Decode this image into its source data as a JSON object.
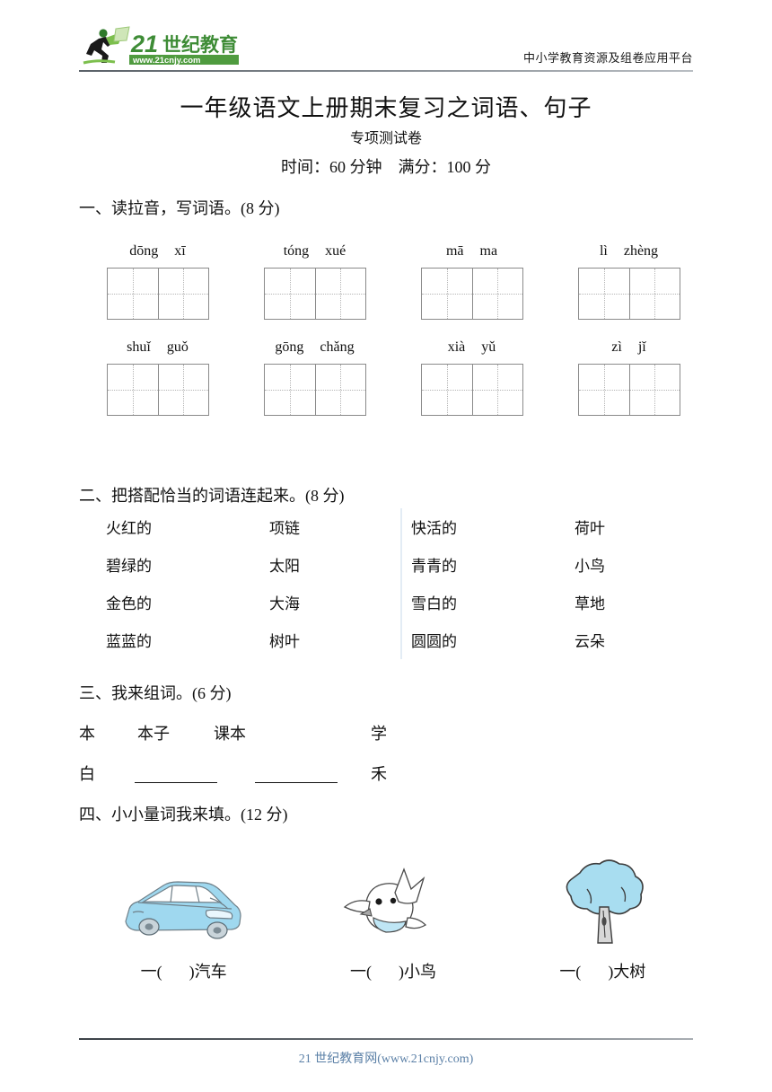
{
  "header": {
    "logo_number": "21",
    "logo_cn": "世纪教育",
    "logo_url": "www.21cnjy.com",
    "tagline": "中小学教育资源及组卷应用平台"
  },
  "title": {
    "main": "一年级语文上册期末复习之词语、句子",
    "sub": "专项测试卷",
    "meta": "时间：60 分钟　满分：100 分"
  },
  "sections": {
    "s1_heading": "一、读拉音，写词语。(8 分)",
    "s2_heading": "二、把搭配恰当的词语连起来。(8 分)",
    "s3_heading": "三、我来组词。(6 分)",
    "s4_heading": "四、小小量词我来填。(12 分)"
  },
  "pinyin": {
    "row1": [
      {
        "s1": "dōng",
        "s2": "xī"
      },
      {
        "s1": "tóng",
        "s2": "xué"
      },
      {
        "s1": "mā",
        "s2": "ma"
      },
      {
        "s1": "lì",
        "s2": "zhèng"
      }
    ],
    "row2": [
      {
        "s1": "shuǐ",
        "s2": "guǒ"
      },
      {
        "s1": "gōng",
        "s2": "chǎng"
      },
      {
        "s1": "xià",
        "s2": "yǔ"
      },
      {
        "s1": "zì",
        "s2": "jǐ"
      }
    ]
  },
  "matching": {
    "left": [
      {
        "a": "火红的",
        "b": "项链"
      },
      {
        "a": "碧绿的",
        "b": "太阳"
      },
      {
        "a": "金色的",
        "b": "大海"
      },
      {
        "a": "蓝蓝的",
        "b": "树叶"
      }
    ],
    "right": [
      {
        "a": "快活的",
        "b": "荷叶"
      },
      {
        "a": "青青的",
        "b": "小鸟"
      },
      {
        "a": "雪白的",
        "b": "草地"
      },
      {
        "a": "圆圆的",
        "b": "云朵"
      }
    ]
  },
  "compose": {
    "row1": {
      "char": "本",
      "word1": "本子",
      "word2": "课本",
      "char2": "学"
    },
    "row2": {
      "char": "白",
      "char2": "禾"
    }
  },
  "pictures": [
    {
      "icon": "car-illustration",
      "label_pre": "一(",
      "label_post": ")汽车"
    },
    {
      "icon": "bird-illustration",
      "label_pre": "一(",
      "label_post": ")小鸟"
    },
    {
      "icon": "tree-illustration",
      "label_pre": "一(",
      "label_post": ")大树"
    }
  ],
  "footer": {
    "text": "21 世纪教育网(www.21cnjy.com)"
  },
  "colors": {
    "logo_green": "#4f9b3f",
    "logo_dark_green": "#2f7a2a",
    "divider_blue": "#e3ecf5",
    "footer_blue": "#5a7fa6",
    "car_blue": "#9fd8ef",
    "tree_blue": "#a8ddf0"
  }
}
